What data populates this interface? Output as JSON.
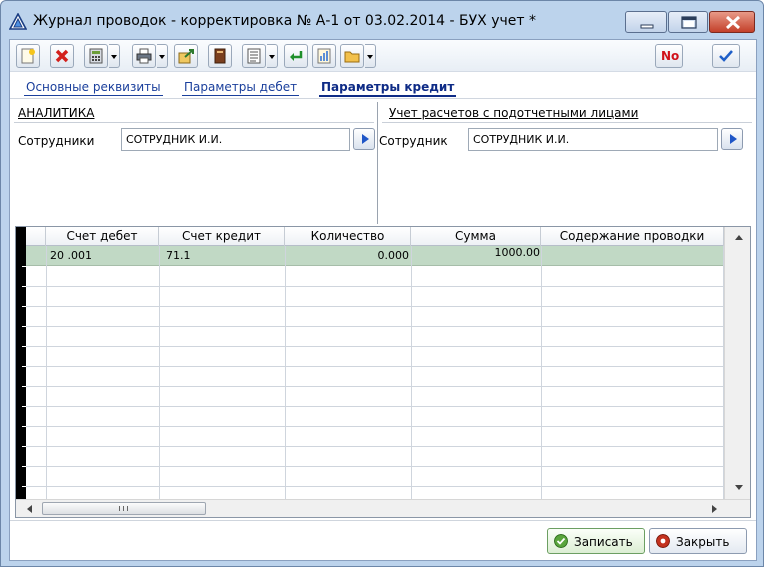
{
  "window": {
    "title": "Журнал проводок - корректировка № А-1 от 03.02.2014 - БУХ учет *"
  },
  "toolbar": {
    "buttons": [
      {
        "name": "new-document-icon"
      },
      {
        "name": "delete-icon"
      },
      {
        "name": "calculator-icon"
      },
      {
        "name": "print-icon"
      },
      {
        "name": "export-icon"
      },
      {
        "name": "book-icon"
      },
      {
        "name": "list-icon"
      },
      {
        "name": "enter-icon"
      },
      {
        "name": "report-icon"
      },
      {
        "name": "folder-icon"
      }
    ],
    "number_button_label": "No",
    "number_button_color": "#d1111a"
  },
  "tabs": [
    {
      "label": "Основные реквизиты",
      "active": false
    },
    {
      "label": "Параметры дебет",
      "active": false
    },
    {
      "label": "Параметры кредит",
      "active": true
    }
  ],
  "analytics": {
    "left_title": "АНАЛИТИКА",
    "left_field_label": "Сотрудники",
    "left_field_value": "СОТРУДНИК И.И.",
    "right_title": "Учет расчетов с подотчетными лицами",
    "right_field_label": "Сотрудник",
    "right_field_value": "СОТРУДНИК И.И."
  },
  "grid": {
    "columns": [
      "Счет дебет",
      "Счет кредит",
      "Количество",
      "Сумма",
      "Содержание проводки"
    ],
    "rows": [
      [
        "20 .001",
        "71.1",
        "0.000",
        "1000.00",
        ""
      ]
    ],
    "selected_row_color": "#c1d9c5",
    "scroll_grip": "III"
  },
  "footer": {
    "save_label": "Записать",
    "close_label": "Закрыть"
  }
}
